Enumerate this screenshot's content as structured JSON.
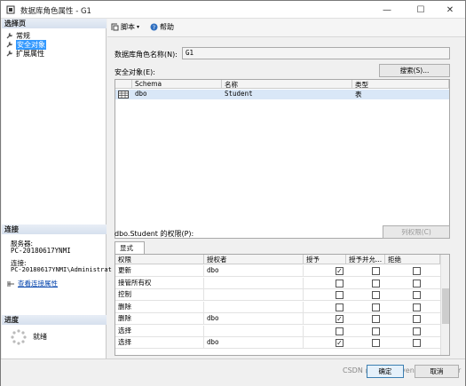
{
  "window": {
    "title": "数据库角色属性 - G1",
    "minimize": "—",
    "maximize": "☐",
    "close": "✕"
  },
  "left_panel": {
    "select_page_header": "选择页",
    "nav_items": [
      {
        "label": "常规",
        "selected": false
      },
      {
        "label": "安全对象",
        "selected": true
      },
      {
        "label": "扩展属性",
        "selected": false
      }
    ],
    "connection_header": "连接",
    "server_label": "服务器:",
    "server_value": "PC-20180617YNMI",
    "connection_label": "连接:",
    "connection_value": "PC-20180617YNMI\\Administrat",
    "view_connection_link": "查看连接属性",
    "progress_header": "进度",
    "progress_status": "就绪"
  },
  "toolbar": {
    "script_label": "脚本",
    "help_label": "帮助"
  },
  "form": {
    "role_name_label": "数据库角色名称(N):",
    "role_name_value": "G1",
    "securables_label": "安全对象(E):",
    "search_button": "搜索(S)...",
    "securables_columns": [
      "Schema",
      "名称",
      "类型"
    ],
    "securables_rows": [
      {
        "schema": "dbo",
        "name": "Student",
        "type": "表"
      }
    ],
    "permissions_label": "dbo.Student 的权限(P):",
    "column_permissions_button": "列权限(C)",
    "tab_explicit": "显式",
    "permissions_columns": [
      "权限",
      "授权者",
      "授予",
      "授予并允...",
      "拒绝"
    ],
    "permissions_rows": [
      {
        "permission": "更新",
        "grantor": "dbo",
        "grant": true,
        "with_grant": false,
        "deny": false
      },
      {
        "permission": "接管所有权",
        "grantor": "",
        "grant": false,
        "with_grant": false,
        "deny": false
      },
      {
        "permission": "控制",
        "grantor": "",
        "grant": false,
        "with_grant": false,
        "deny": false
      },
      {
        "permission": "删除",
        "grantor": "",
        "grant": false,
        "with_grant": false,
        "deny": false
      },
      {
        "permission": "删除",
        "grantor": "dbo",
        "grant": true,
        "with_grant": false,
        "deny": false
      },
      {
        "permission": "选择",
        "grantor": "",
        "grant": false,
        "with_grant": false,
        "deny": false
      },
      {
        "permission": "选择",
        "grantor": "dbo",
        "grant": true,
        "with_grant": false,
        "deny": false
      }
    ]
  },
  "footer": {
    "ok_button": "确定",
    "cancel_button": "取消",
    "watermark": "CSDN @KingsHoven Schumacher"
  },
  "colors": {
    "selection": "#3399ff",
    "row_highlight": "#d9e7f7",
    "link": "#0645ad"
  }
}
